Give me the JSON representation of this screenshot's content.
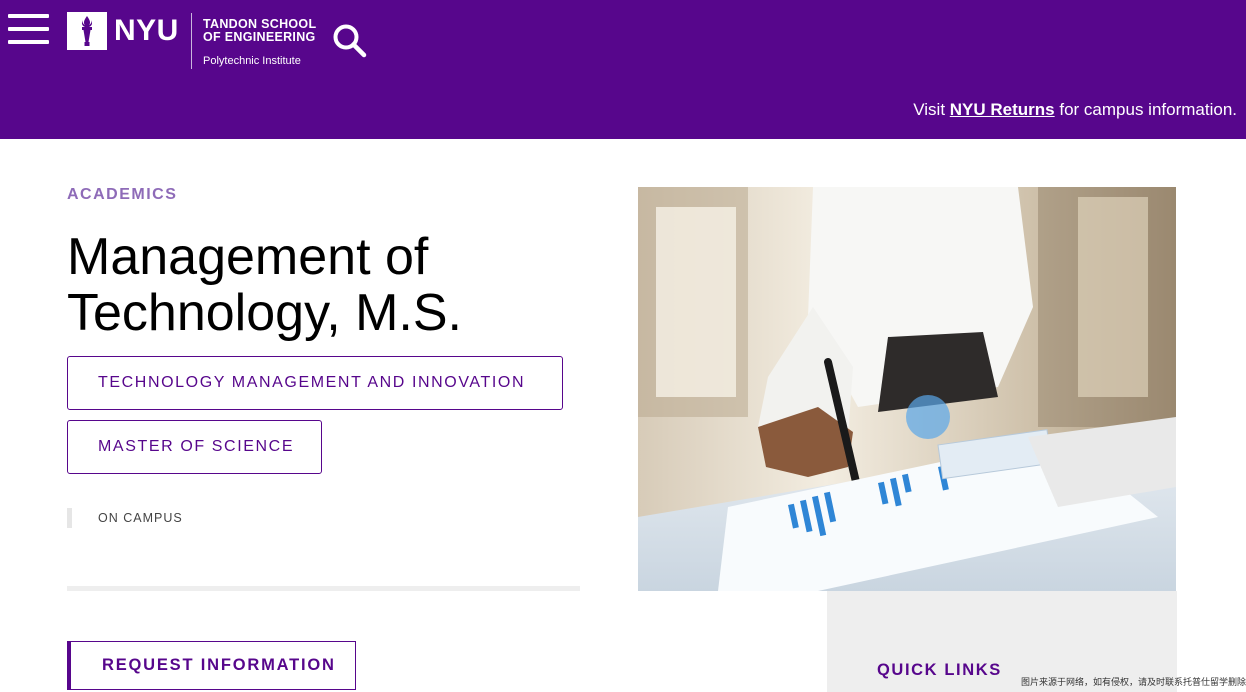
{
  "header": {
    "logo": {
      "wordmark": "NYU",
      "school_line1": "TANDON SCHOOL",
      "school_line2": "OF ENGINEERING",
      "subtitle": "Polytechnic Institute"
    },
    "notice": {
      "prefix": "Visit ",
      "link": "NYU Returns",
      "suffix": " for campus information."
    },
    "icons": {
      "menu": "hamburger-menu-icon",
      "search": "search-icon",
      "logo": "nyu-torch-logo"
    }
  },
  "main": {
    "eyebrow": "ACADEMICS",
    "title_line1": "Management of",
    "title_line2": "Technology, M.S.",
    "tags": [
      "TECHNOLOGY MANAGEMENT AND INNOVATION",
      "MASTER OF SCIENCE"
    ],
    "mode": "ON CAMPUS",
    "request_button": "REQUEST INFORMATION"
  },
  "sidebar": {
    "quick_links_title": "QUICK LINKS"
  },
  "watermark": "图片来源于网络，如有侵权，请及时联系托普仕留学删除",
  "colors": {
    "brand_purple": "#57068c",
    "eyebrow_purple": "#8e6bb8",
    "panel_gray": "#eeeeee"
  }
}
